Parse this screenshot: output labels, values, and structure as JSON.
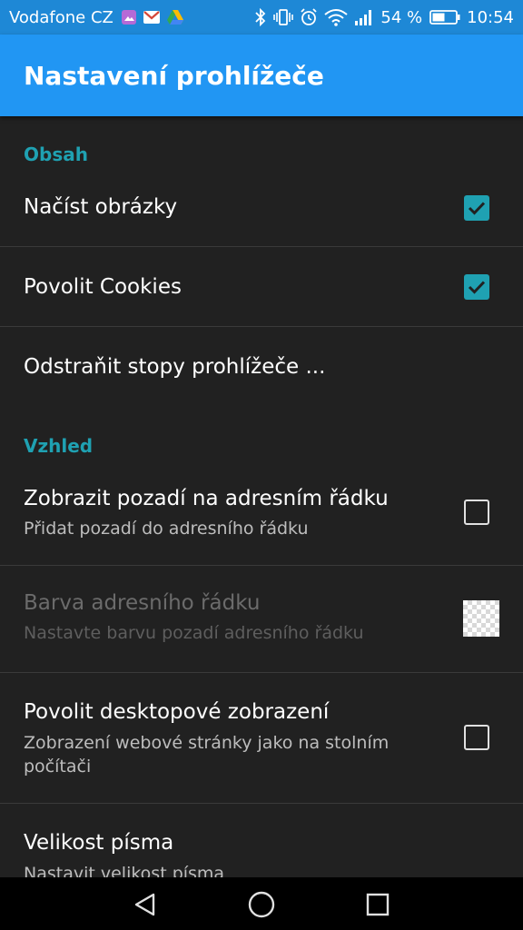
{
  "status_bar": {
    "carrier": "Vodafone CZ",
    "battery_percent": "54 %",
    "time": "10:54",
    "icons": [
      "gallery-icon",
      "gmail-icon",
      "drive-icon",
      "bluetooth-icon",
      "vibrate-icon",
      "alarm-icon",
      "wifi-icon",
      "signal-icon",
      "battery-icon"
    ]
  },
  "app_bar": {
    "title": "Nastavení prohlížeče"
  },
  "sections": {
    "content": {
      "header": "Obsah"
    },
    "appearance": {
      "header": "Vzhled"
    }
  },
  "settings": {
    "load_images": {
      "title": "Načíst obrázky",
      "checked": true
    },
    "allow_cookies": {
      "title": "Povolit Cookies",
      "checked": true
    },
    "clear_traces": {
      "title": "Odstraňit stopy prohlížeče ..."
    },
    "address_bg": {
      "title": "Zobrazit pozadí na adresním řádku",
      "summary": "Přidat pozadí do adresního řádku",
      "checked": false
    },
    "address_color": {
      "title": "Barva adresního řádku",
      "summary": "Nastavte barvu pozadí adresního řádku",
      "enabled": false
    },
    "desktop_view": {
      "title": "Povolit desktopové zobrazení",
      "summary": "Zobrazení webové stránky jako na stolním počítači",
      "checked": false
    },
    "font_size": {
      "title": "Velikost písma",
      "summary": "Nastavit velikost písma"
    }
  },
  "colors": {
    "status_bar": "#1e88d6",
    "app_bar": "#2196f3",
    "accent": "#1fa1b2",
    "background": "#212121"
  },
  "nav_bar": {
    "icons": [
      "back-icon",
      "home-icon",
      "recents-icon"
    ]
  }
}
